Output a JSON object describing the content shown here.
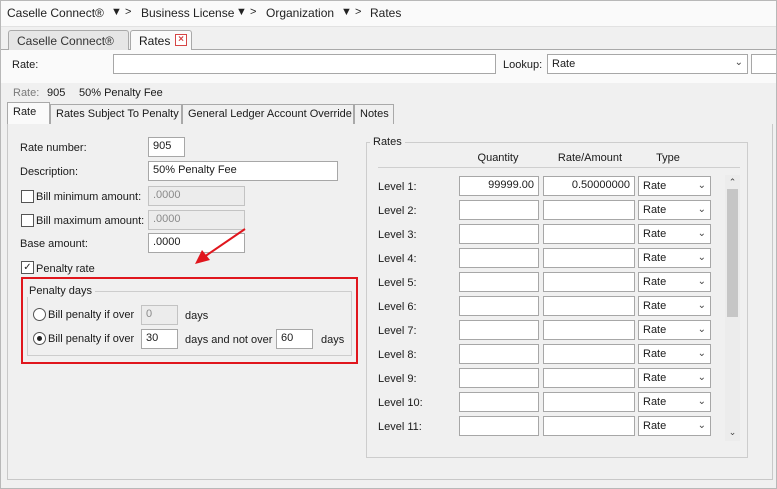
{
  "breadcrumb": {
    "items": [
      "Caselle Connect®",
      "Business License",
      "Organization",
      "Rates"
    ],
    "separators": [
      "▼ >",
      "▼ >",
      "▼ >"
    ]
  },
  "doc_tabs": {
    "tab1": "Caselle Connect®",
    "tab2": "Rates",
    "close_glyph": "×"
  },
  "lookup": {
    "rate_label": "Rate:",
    "rate_value": "",
    "lookup_label": "Lookup:",
    "lookup_value": "Rate"
  },
  "summary": {
    "label": "Rate:",
    "number": "905",
    "description": "50% Penalty Fee"
  },
  "tabs": [
    "Rate",
    "Rates Subject To Penalty",
    "General Ledger Account Override",
    "Notes"
  ],
  "form": {
    "rate_number_label": "Rate number:",
    "rate_number": "905",
    "description_label": "Description:",
    "description": "50% Penalty Fee",
    "bill_min_label": "Bill minimum amount:",
    "bill_min_value": ".0000",
    "bill_max_label": "Bill maximum amount:",
    "bill_max_value": ".0000",
    "base_amount_label": "Base amount:",
    "base_amount_value": ".0000",
    "penalty_rate_label": "Penalty rate",
    "check_glyph": "✓"
  },
  "penalty_days": {
    "title": "Penalty days",
    "option1_label": "Bill penalty if over",
    "option1_value": "0",
    "option1_suffix": "days",
    "option2_label": "Bill penalty if over",
    "option2_value": "30",
    "option2_mid": "days and not over",
    "option2_value2": "60",
    "option2_suffix": "days"
  },
  "rates": {
    "title": "Rates",
    "headers": [
      "Quantity",
      "Rate/Amount",
      "Type"
    ],
    "rows": [
      {
        "level": "Level 1:",
        "quantity": "99999.00",
        "amount": "0.50000000",
        "type": "Rate"
      },
      {
        "level": "Level 2:",
        "quantity": "",
        "amount": "",
        "type": "Rate"
      },
      {
        "level": "Level 3:",
        "quantity": "",
        "amount": "",
        "type": "Rate"
      },
      {
        "level": "Level 4:",
        "quantity": "",
        "amount": "",
        "type": "Rate"
      },
      {
        "level": "Level 5:",
        "quantity": "",
        "amount": "",
        "type": "Rate"
      },
      {
        "level": "Level 6:",
        "quantity": "",
        "amount": "",
        "type": "Rate"
      },
      {
        "level": "Level 7:",
        "quantity": "",
        "amount": "",
        "type": "Rate"
      },
      {
        "level": "Level 8:",
        "quantity": "",
        "amount": "",
        "type": "Rate"
      },
      {
        "level": "Level 9:",
        "quantity": "",
        "amount": "",
        "type": "Rate"
      },
      {
        "level": "Level 10:",
        "quantity": "",
        "amount": "",
        "type": "Rate"
      },
      {
        "level": "Level 11:",
        "quantity": "",
        "amount": "",
        "type": "Rate"
      }
    ]
  },
  "colors": {
    "annotation_red": "#e0161d",
    "close_red": "#d64545"
  }
}
